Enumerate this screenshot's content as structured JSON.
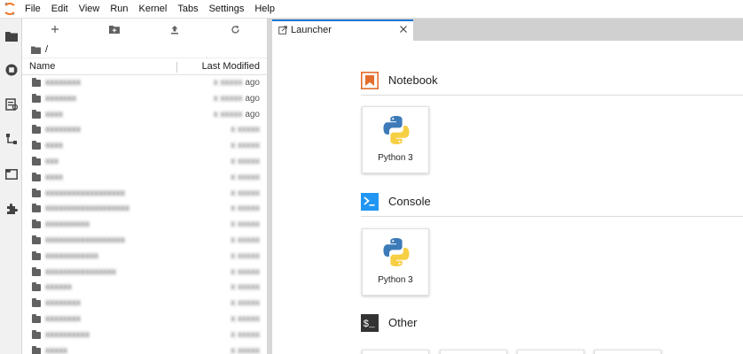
{
  "menubar": {
    "items": [
      "File",
      "Edit",
      "View",
      "Run",
      "Kernel",
      "Tabs",
      "Settings",
      "Help"
    ]
  },
  "activity": {
    "icons": [
      "folder-icon",
      "running-icon",
      "commands-icon",
      "property-inspector-icon",
      "tabs-icon",
      "extension-icon"
    ]
  },
  "filebrowser": {
    "toolbar": [
      "new-launcher",
      "new-folder",
      "upload",
      "refresh"
    ],
    "path": "/",
    "header_name": "Name",
    "header_modified": "Last Modified",
    "rows": [
      {
        "name": "xxxxxxxx",
        "modified_tail": "ago"
      },
      {
        "name": "xxxxxxx",
        "modified_tail": "ago"
      },
      {
        "name": "xxxx",
        "modified_tail": "ago"
      },
      {
        "name": "xxxxxxxx",
        "modified_tail": ""
      },
      {
        "name": "xxxx",
        "modified_tail": ""
      },
      {
        "name": "xxx",
        "modified_tail": ""
      },
      {
        "name": "xxxx",
        "modified_tail": ""
      },
      {
        "name": "xxxxxxxxxxxxxxxxxx",
        "modified_tail": ""
      },
      {
        "name": "xxxxxxxxxxxxxxxxxxx",
        "modified_tail": ""
      },
      {
        "name": "xxxxxxxxxx",
        "modified_tail": ""
      },
      {
        "name": "xxxxxxxxxxxxxxxxxx",
        "modified_tail": ""
      },
      {
        "name": "xxxxxxxxxxxx",
        "modified_tail": ""
      },
      {
        "name": "xxxxxxxxxxxxxxxx",
        "modified_tail": ""
      },
      {
        "name": "xxxxxx",
        "modified_tail": ""
      },
      {
        "name": "xxxxxxxx",
        "modified_tail": ""
      },
      {
        "name": "xxxxxxxx",
        "modified_tail": ""
      },
      {
        "name": "xxxxxxxxxx",
        "modified_tail": ""
      },
      {
        "name": "xxxxx",
        "modified_tail": ""
      }
    ],
    "modified_blur": "x xxxxx"
  },
  "tab": {
    "label": "Launcher"
  },
  "launcher": {
    "notebook": {
      "title": "Notebook",
      "kernel": "Python 3"
    },
    "console": {
      "title": "Console",
      "kernel": "Python 3"
    },
    "other": {
      "title": "Other"
    }
  },
  "colors": {
    "accent": "#1976d2",
    "notebook_orange": "#e46e2e",
    "console_blue": "#2196f3",
    "other_dark": "#333333"
  }
}
